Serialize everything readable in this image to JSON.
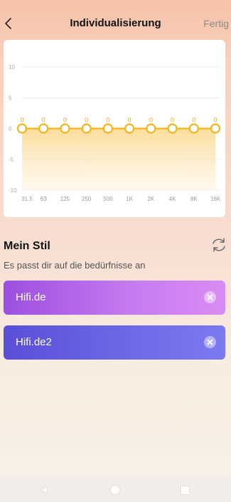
{
  "header": {
    "title": "Individualisierung",
    "done_label": "Fertig",
    "back_icon": "chevron-left-icon"
  },
  "equalizer": {
    "y_ticks": [
      "10",
      "5",
      "0",
      "-5",
      "-10"
    ],
    "bands": [
      "31.5",
      "63",
      "125",
      "250",
      "500",
      "1K",
      "2K",
      "4K",
      "8K",
      "16K"
    ],
    "gains": [
      0,
      0,
      0,
      0,
      0,
      0,
      0,
      0,
      0,
      0
    ],
    "y_range": [
      -10,
      10
    ],
    "line_color": "#f2b51c",
    "fill_color": "#fde8b8"
  },
  "my_style": {
    "title": "Mein Stil",
    "subtitle": "Es passt dir auf die bedürfnisse an",
    "refresh_icon": "refresh-icon",
    "items": [
      {
        "label": "Hifi.de",
        "color": "#a95ae6"
      },
      {
        "label": "Hifi.de2",
        "color": "#6561e1"
      }
    ]
  },
  "navbar": {
    "back_icon": "triangle-back-icon",
    "home_icon": "circle-home-icon",
    "recent_icon": "square-recent-icon"
  }
}
